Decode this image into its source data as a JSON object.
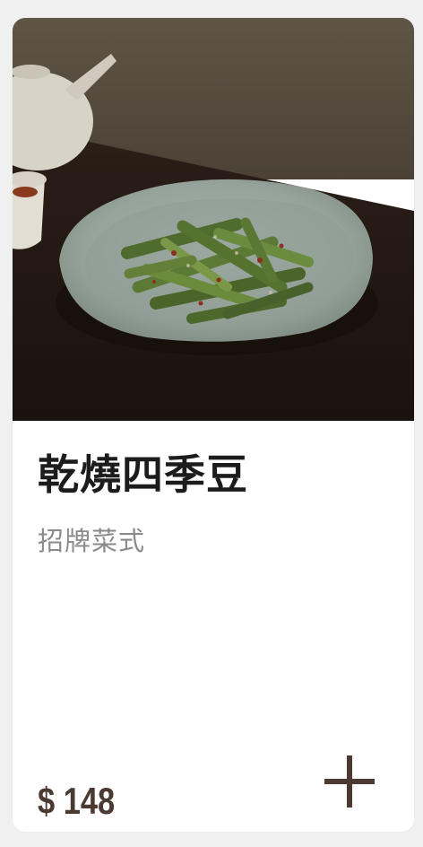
{
  "dish": {
    "name": "乾燒四季豆",
    "tag": "招牌菜式",
    "price": "$ 148"
  },
  "icons": {
    "add": "plus-icon"
  },
  "colors": {
    "price": "#4a3a32",
    "plus": "#4a3a32",
    "name": "#1c1c1c",
    "tag": "#8a8a8a"
  }
}
